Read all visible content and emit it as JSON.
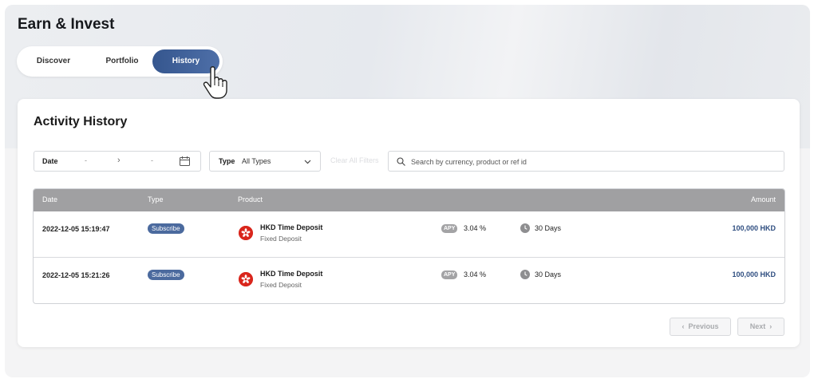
{
  "page": {
    "title": "Earn & Invest"
  },
  "tabs": [
    {
      "label": "Discover",
      "active": false
    },
    {
      "label": "Portfolio",
      "active": false
    },
    {
      "label": "History",
      "active": true
    }
  ],
  "card": {
    "title": "Activity History"
  },
  "filters": {
    "date_label": "Date",
    "date_from": "-",
    "date_to": "-",
    "type_label": "Type",
    "type_value": "All Types",
    "clear_label": "Clear All Filters",
    "search_placeholder": "Search by currency, product or ref id"
  },
  "table": {
    "headers": {
      "date": "Date",
      "type": "Type",
      "product": "Product",
      "amount": "Amount"
    },
    "rows": [
      {
        "date": "2022-12-05 15:19:47",
        "type": "Subscribe",
        "product_name": "HKD Time Deposit",
        "product_sub": "Fixed Deposit",
        "apy_label": "APY",
        "apy": "3.04 %",
        "term": "30 Days",
        "amount": "100,000 HKD"
      },
      {
        "date": "2022-12-05 15:21:26",
        "type": "Subscribe",
        "product_name": "HKD Time Deposit",
        "product_sub": "Fixed Deposit",
        "apy_label": "APY",
        "apy": "3.04 %",
        "term": "30 Days",
        "amount": "100,000 HKD"
      }
    ]
  },
  "pagination": {
    "previous": "Previous",
    "next": "Next"
  },
  "colors": {
    "accent": "#3f5f96",
    "amount": "#2f4e80",
    "flag": "#d9261c"
  }
}
